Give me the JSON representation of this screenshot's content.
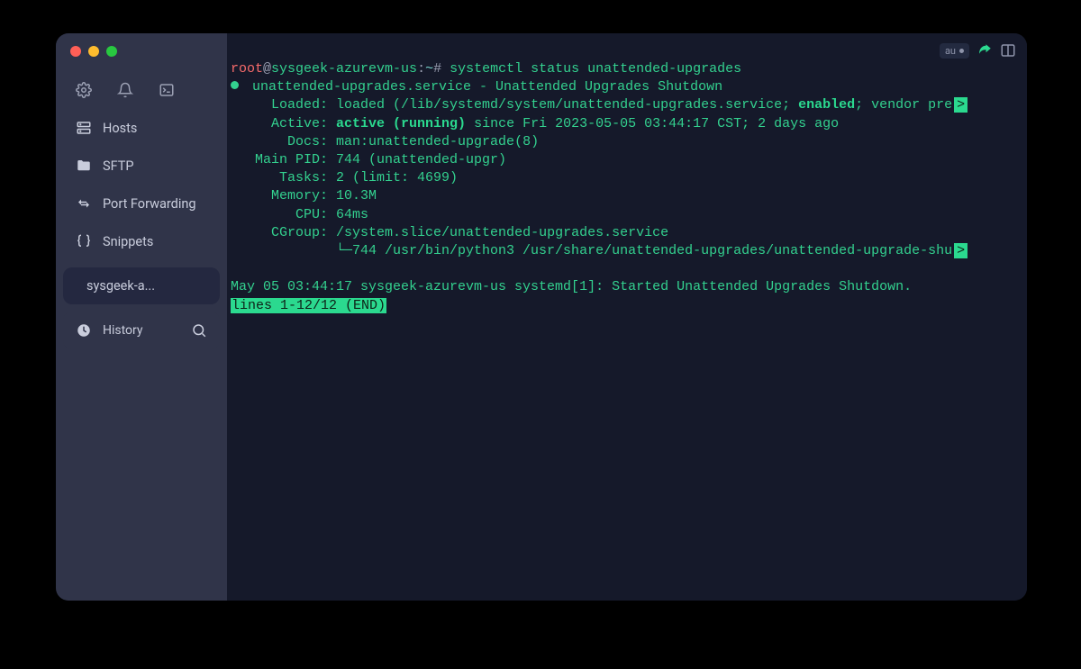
{
  "sidebar": {
    "nav": [
      {
        "id": "hosts",
        "label": "Hosts",
        "icon": "server-icon"
      },
      {
        "id": "sftp",
        "label": "SFTP",
        "icon": "folder-icon"
      },
      {
        "id": "portforwarding",
        "label": "Port Forwarding",
        "icon": "arrows-icon"
      },
      {
        "id": "snippets",
        "label": "Snippets",
        "icon": "braces-icon"
      }
    ],
    "active_tab_label": "sysgeek-a...",
    "history_label": "History"
  },
  "toolbar_chip": "au",
  "prompt": {
    "user": "root",
    "at": "@",
    "host": "sysgeek-azurevm-us",
    "colon": ":",
    "cwd": "~",
    "hash": "# "
  },
  "command": "systemctl status unattended-upgrades",
  "status": {
    "unit_line": " unattended-upgrades.service - Unattended Upgrades Shutdown",
    "loaded_label": "     Loaded: ",
    "loaded_value": "loaded (/lib/systemd/system/unattended-upgrades.service; ",
    "loaded_enabled": "enabled",
    "loaded_tail": "; vendor pre",
    "active_label": "     Active: ",
    "active_state": "active (running)",
    "active_tail": " since Fri 2023-05-05 03:44:17 CST; 2 days ago",
    "docs_label": "       Docs: ",
    "docs_value": "man:unattended-upgrade(8)",
    "mainpid_label": "   Main PID: ",
    "mainpid_value": "744 (unattended-upgr)",
    "tasks_label": "      Tasks: ",
    "tasks_value": "2 (limit: 4699)",
    "memory_label": "     Memory: ",
    "memory_value": "10.3M",
    "cpu_label": "        CPU: ",
    "cpu_value": "64ms",
    "cgroup_label": "     CGroup: ",
    "cgroup_value": "/system.slice/unattended-upgrades.service",
    "cgroup_tree": "             └─744 /usr/bin/python3 /usr/share/unattended-upgrades/unattended-upgrade-shu",
    "blank": "",
    "log_line": "May 05 03:44:17 sysgeek-azurevm-us systemd[1]: Started Unattended Upgrades Shutdown.",
    "pager": "lines 1-12/12 (END)"
  }
}
